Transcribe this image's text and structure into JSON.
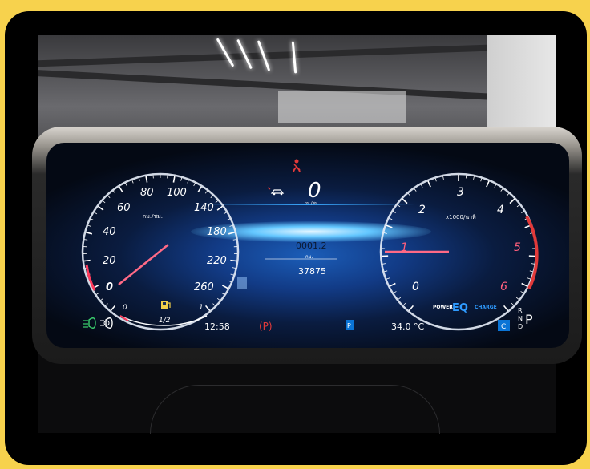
{
  "speedometer": {
    "unit": "กม./ชม.",
    "ticks": [
      "0",
      "20",
      "40",
      "60",
      "80",
      "100",
      "140",
      "180",
      "220",
      "260"
    ],
    "needle_value": 0
  },
  "center": {
    "speed": "0",
    "speed_unit": "กม./ชม.",
    "trip": "0001.2",
    "trip_unit": "กม.",
    "odometer": "37875"
  },
  "tachometer": {
    "unit": "x1000/นาที",
    "ticks": [
      "0",
      "1",
      "2",
      "3",
      "4",
      "5",
      "6"
    ],
    "needle_value": 1,
    "power_label": "POWER",
    "eq_label": "EQ",
    "charge_label": "CHARGE"
  },
  "fuel": {
    "empty": "0",
    "half": "1/2",
    "full": "1"
  },
  "status": {
    "time": "12:58",
    "parking_brake": "(P)",
    "parking_badge": "P",
    "temperature": "34.0 °C",
    "mode_badge": "C",
    "gear_r": "R",
    "gear_n": "N",
    "gear_d": "D",
    "gear_p": "P"
  },
  "colors": {
    "frame": "#f7d24d",
    "accent_blue": "#2f9bff",
    "needle_red": "#ff3b5c",
    "warning_red": "#e23a3a",
    "indicator_green": "#3bd16f"
  },
  "icons": {
    "seatbelt": "seatbelt-warning-icon",
    "car_assist": "car-assist-icon",
    "headlight": "headlight-icon",
    "auto_headlight": "auto-headlight-icon",
    "fuel": "fuel-pump-icon"
  }
}
